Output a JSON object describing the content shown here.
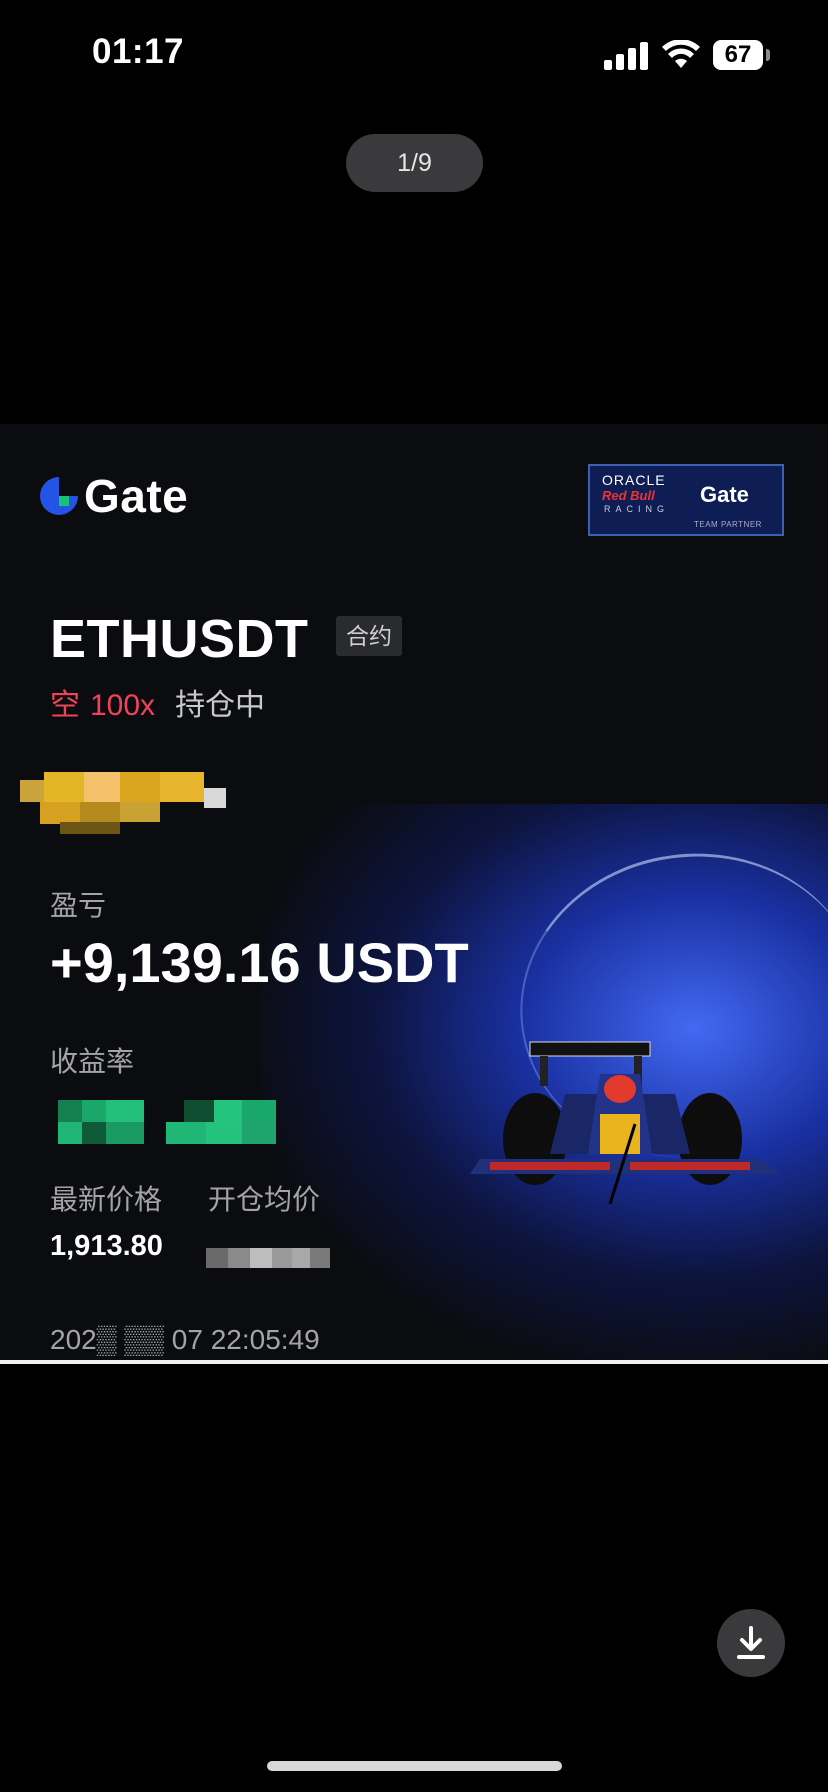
{
  "status_bar": {
    "time": "01:17",
    "battery": "67",
    "icons": [
      "signal-icon",
      "wifi-icon",
      "battery-icon"
    ]
  },
  "viewer": {
    "page_indicator": "1/9",
    "download_icon": "download-icon"
  },
  "card": {
    "brand": "Gate",
    "partner_badge": {
      "oracle": "ORACLE",
      "redbull": "Red Bull",
      "racing": "RACING",
      "gate": "Gate",
      "partner": "TEAM PARTNER"
    },
    "pair": "ETHUSDT",
    "contract_tag": "合约",
    "side": "空",
    "leverage": "100x",
    "position_status": "持仓中",
    "pnl_label": "盈亏",
    "pnl_value": "+9,139.16 USDT",
    "roi_label": "收益率",
    "last_price_label": "最新价格",
    "entry_price_label": "开仓均价",
    "last_price_value": "1,913.80",
    "timestamp_visible": "202▒ ▒▒ 07 22:05:49",
    "colors": {
      "short": "#f0435a",
      "gain": "#1ac07a",
      "brand_blue": "#2354e6"
    }
  }
}
